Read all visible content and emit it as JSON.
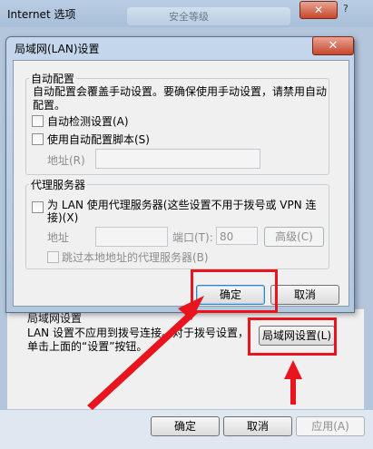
{
  "outer_window": {
    "title": "Internet 选项",
    "tab_placeholder": "安全等级",
    "close_glyph": "✕",
    "help_glyph": "?",
    "lan_section_title": "局域网设置",
    "lan_description": "LAN 设置不应用到拨号连接。对于拨号设置，单击上面的“设置”按钮。",
    "lan_settings_button": "局域网设置(L)",
    "buttons": {
      "ok": "确定",
      "cancel": "取消",
      "apply": "应用(A)"
    }
  },
  "lan_dialog": {
    "title": "局域网(LAN)设置",
    "close_glyph": "✕",
    "auto_config": {
      "legend": "自动配置",
      "description": "自动配置会覆盖手动设置。要确保使用手动设置，请禁用自动配置。",
      "auto_detect_label": "自动检测设置(A)",
      "use_script_label": "使用自动配置脚本(S)",
      "address_label": "地址(R)",
      "address_value": ""
    },
    "proxy": {
      "legend": "代理服务器",
      "use_proxy_label": "为 LAN 使用代理服务器(这些设置不用于拨号或 VPN 连接)(X)",
      "address_label": "地址",
      "address_value": "",
      "port_label": "端口(T):",
      "port_value": "80",
      "advanced_button": "高级(C)",
      "bypass_label": "跳过本地地址的代理服务器(B)"
    },
    "buttons": {
      "ok": "确定",
      "cancel": "取消"
    }
  },
  "annotations": {
    "highlight_color": "#e8141e"
  }
}
